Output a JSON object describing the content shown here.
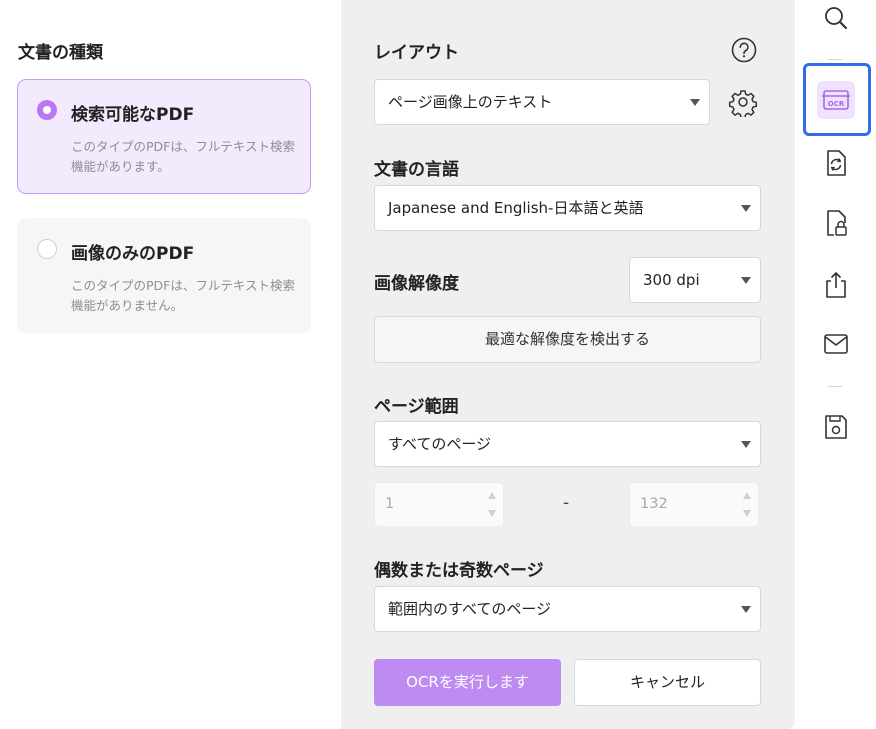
{
  "doc_type": {
    "title": "文書の種類",
    "options": [
      {
        "title": "検索可能なPDF",
        "desc": "このタイプのPDFは、フルテキスト検索機能があります。",
        "selected": true
      },
      {
        "title": "画像のみのPDF",
        "desc": "このタイプのPDFは、フルテキスト検索機能がありません。",
        "selected": false
      }
    ]
  },
  "settings": {
    "layout_label": "レイアウト",
    "layout_value": "ページ画像上のテキスト",
    "language_label": "文書の言語",
    "language_value": "Japanese and English-日本語と英語",
    "resolution_label": "画像解像度",
    "resolution_value": "300 dpi",
    "detect_button": "最適な解像度を検出する",
    "page_range_label": "ページ範囲",
    "page_range_value": "すべてのページ",
    "range_from": "1",
    "range_sep": "-",
    "range_to": "132",
    "odd_even_label": "偶数または奇数ページ",
    "odd_even_value": "範囲内のすべてのページ",
    "run_button": "OCRを実行します",
    "cancel_button": "キャンセル"
  },
  "colors": {
    "accent": "#bd8bf2",
    "selected_card_bg": "#f4eafe",
    "highlight_border": "#2f6ee6"
  },
  "toolbar": {
    "icons": [
      "search-icon",
      "ocr-icon",
      "convert-icon",
      "protect-icon",
      "share-icon",
      "mail-icon",
      "save-icon"
    ]
  }
}
